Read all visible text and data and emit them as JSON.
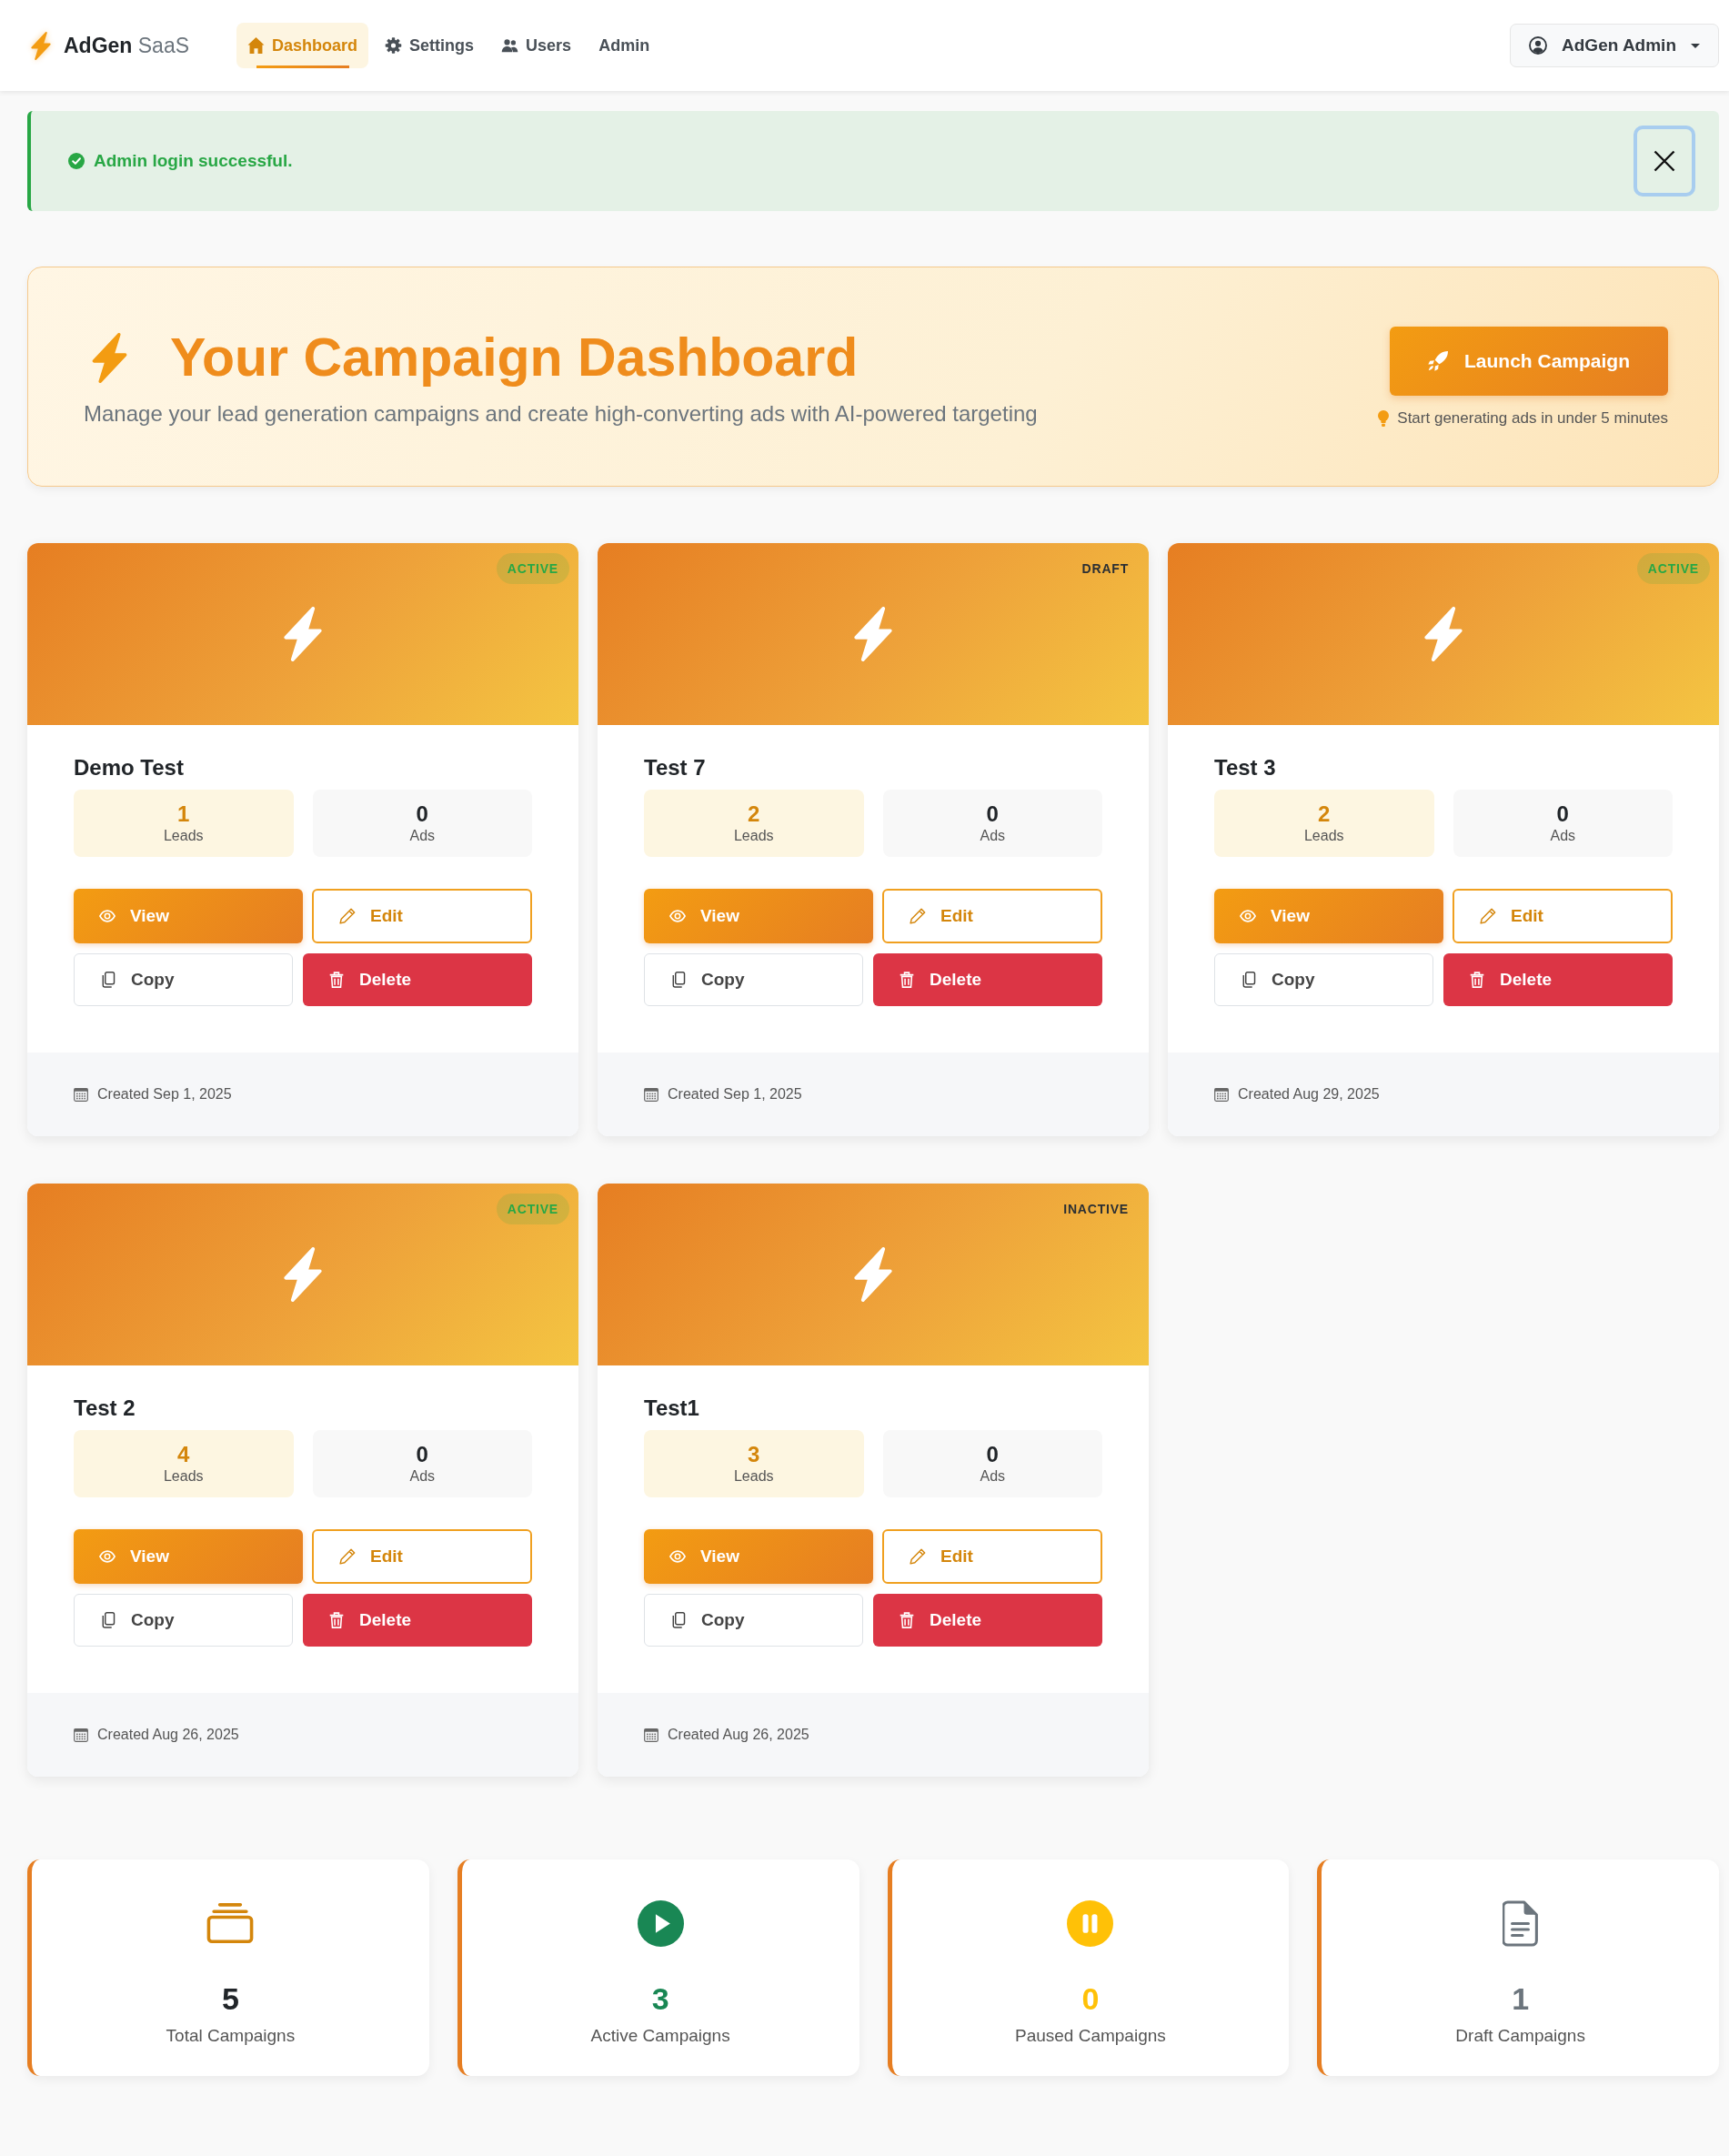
{
  "navbar": {
    "brand": "**AdGen** SaaS",
    "items": [
      {
        "label": "Dashboard",
        "selected": true
      },
      {
        "label": "Settings",
        "selected": false
      },
      {
        "label": "Users",
        "selected": false
      },
      {
        "label": "Admin",
        "selected": false
      }
    ],
    "user_menu": {
      "label": "AdGen Admin"
    }
  },
  "alert": {
    "message": "Admin login successful.",
    "close_focused": true
  },
  "hero": {
    "title": "Your Campaign Dashboard",
    "subtitle": "Manage your lead generation campaigns and create high-converting ads with AI-powered targeting",
    "button": "Launch Campaign",
    "note": "Start generating ads in under 5 minutes"
  },
  "campaigns": [
    {
      "name": "Demo Test",
      "status": {
        "label": "ACTIVE",
        "kind": "active"
      },
      "metrics": [
        {
          "value": "1",
          "label": "Leads"
        },
        {
          "value": "0",
          "label": "Ads"
        }
      ],
      "actions": [
        {
          "label": "View",
          "kind": "view"
        },
        {
          "label": "Edit",
          "kind": "edit"
        },
        {
          "label": "Copy",
          "kind": "copy"
        },
        {
          "label": "Delete",
          "kind": "delete"
        }
      ],
      "created": "Created Sep 1, 2025"
    },
    {
      "name": "Test 7",
      "status": {
        "label": "DRAFT",
        "kind": "draft"
      },
      "metrics": [
        {
          "value": "2",
          "label": "Leads"
        },
        {
          "value": "0",
          "label": "Ads"
        }
      ],
      "actions": [
        {
          "label": "View",
          "kind": "view"
        },
        {
          "label": "Edit",
          "kind": "edit"
        },
        {
          "label": "Copy",
          "kind": "copy"
        },
        {
          "label": "Delete",
          "kind": "delete"
        }
      ],
      "created": "Created Sep 1, 2025"
    },
    {
      "name": "Test 3",
      "status": {
        "label": "ACTIVE",
        "kind": "active"
      },
      "metrics": [
        {
          "value": "2",
          "label": "Leads"
        },
        {
          "value": "0",
          "label": "Ads"
        }
      ],
      "actions": [
        {
          "label": "View",
          "kind": "view"
        },
        {
          "label": "Edit",
          "kind": "edit"
        },
        {
          "label": "Copy",
          "kind": "copy"
        },
        {
          "label": "Delete",
          "kind": "delete"
        }
      ],
      "created": "Created Aug 29, 2025"
    },
    {
      "name": "Test 2",
      "status": {
        "label": "ACTIVE",
        "kind": "active"
      },
      "metrics": [
        {
          "value": "4",
          "label": "Leads"
        },
        {
          "value": "0",
          "label": "Ads"
        }
      ],
      "actions": [
        {
          "label": "View",
          "kind": "view"
        },
        {
          "label": "Edit",
          "kind": "edit"
        },
        {
          "label": "Copy",
          "kind": "copy"
        },
        {
          "label": "Delete",
          "kind": "delete"
        }
      ],
      "created": "Created Aug 26, 2025"
    },
    {
      "name": "Test1",
      "status": {
        "label": "INACTIVE",
        "kind": "inactive"
      },
      "metrics": [
        {
          "value": "3",
          "label": "Leads"
        },
        {
          "value": "0",
          "label": "Ads"
        }
      ],
      "actions": [
        {
          "label": "View",
          "kind": "view"
        },
        {
          "label": "Edit",
          "kind": "edit"
        },
        {
          "label": "Copy",
          "kind": "copy"
        },
        {
          "label": "Delete",
          "kind": "delete"
        }
      ],
      "created": "Created Aug 26, 2025"
    }
  ],
  "summary": [
    {
      "kind": "total",
      "value": "5",
      "label": "Total Campaigns"
    },
    {
      "kind": "active",
      "value": "3",
      "label": "Active Campaigns"
    },
    {
      "kind": "paused",
      "value": "0",
      "label": "Paused Campaigns"
    },
    {
      "kind": "draft",
      "value": "1",
      "label": "Draft Campaigns"
    }
  ]
}
